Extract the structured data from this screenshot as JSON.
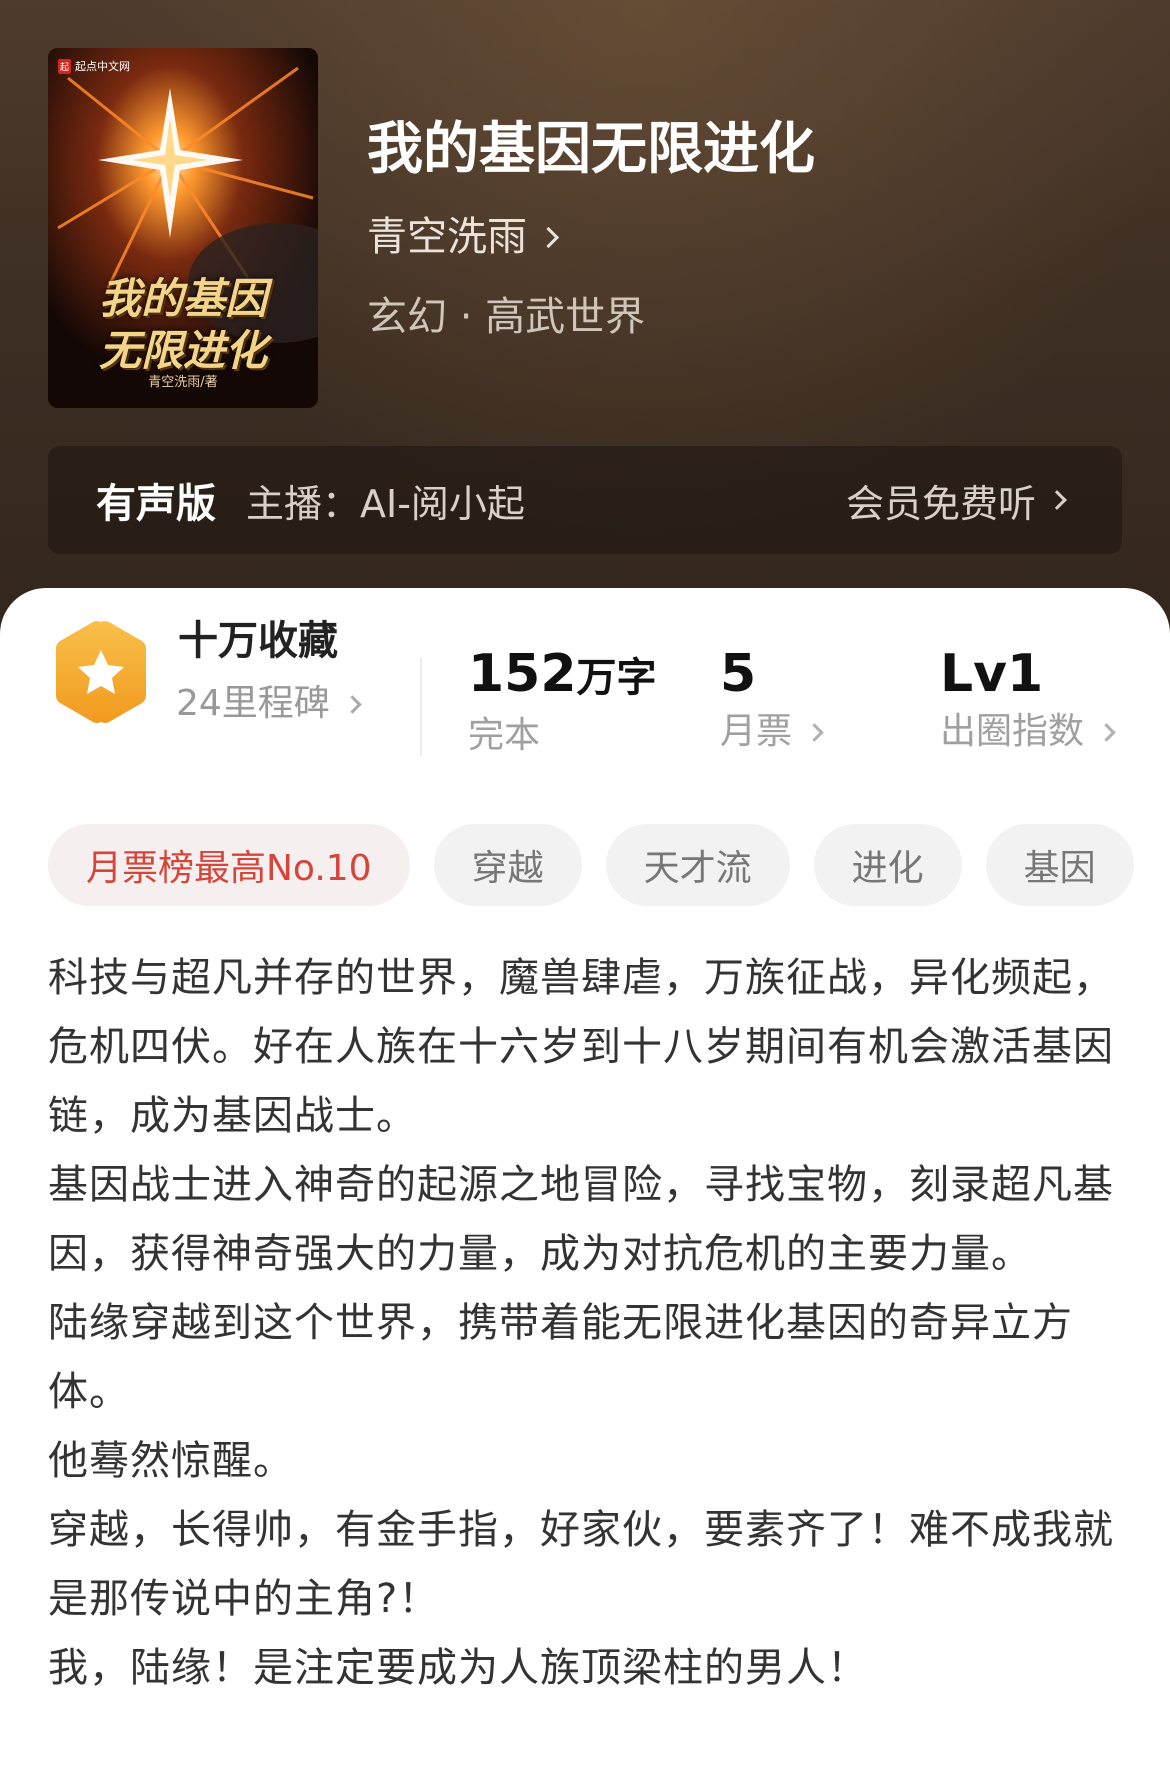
{
  "book": {
    "title": "我的基因无限进化",
    "author": "青空洗雨",
    "genre": "玄幻 · 高武世界",
    "cover": {
      "publisher": "起点中文网",
      "publisher_mark": "起",
      "title_line1": "我的基因",
      "title_line2": "无限进化",
      "author_credit": "青空洗雨/著"
    }
  },
  "audio": {
    "badge": "有声版",
    "host": "主播：AI-阅小起",
    "cta": "会员免费听"
  },
  "milestone": {
    "title": "十万收藏",
    "subtitle": "24里程碑",
    "icon": "star-icon",
    "color": "#f5a623"
  },
  "stats": {
    "words_value": "152",
    "words_unit": "万字",
    "words_label": "完本",
    "tickets_value": "5",
    "tickets_label": "月票",
    "level_value": "Lv1",
    "level_label": "出圈指数"
  },
  "tags": [
    "月票榜最高No.10",
    "穿越",
    "天才流",
    "进化",
    "基因"
  ],
  "synopsis": [
    "科技与超凡并存的世界，魔兽肆虐，万族征战，异化频起，危机四伏。好在人族在十六岁到十八岁期间有机会激活基因链，成为基因战士。",
    "基因战士进入神奇的起源之地冒险，寻找宝物，刻录超凡基因，获得神奇强大的力量，成为对抗危机的主要力量。",
    "陆缘穿越到这个世界，携带着能无限进化基因的奇异立方体。",
    "他蓦然惊醒。",
    "穿越，长得帅，有金手指，好家伙，要素齐了！难不成我就是那传说中的主角?！",
    "我，陆缘！是注定要成为人族顶梁柱的男人！"
  ],
  "colors": {
    "accent_red": "#d5453a",
    "hero_bg": "#3e2f24"
  }
}
